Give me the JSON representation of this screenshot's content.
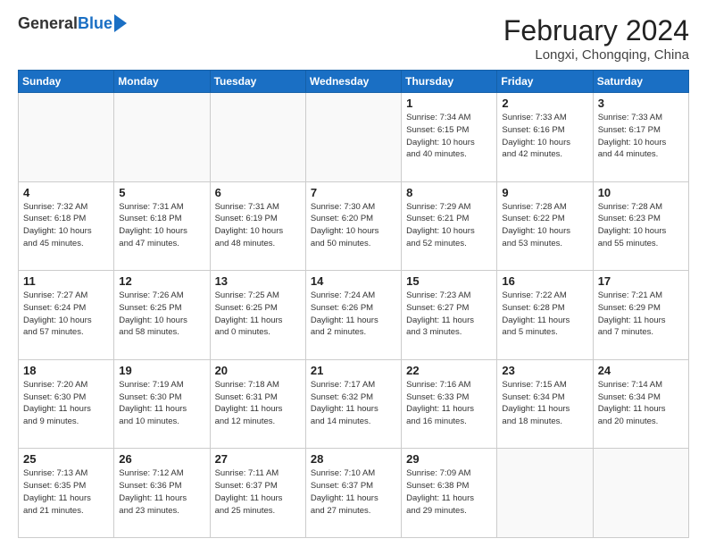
{
  "logo": {
    "general": "General",
    "blue": "Blue"
  },
  "title": {
    "month_year": "February 2024",
    "location": "Longxi, Chongqing, China"
  },
  "headers": [
    "Sunday",
    "Monday",
    "Tuesday",
    "Wednesday",
    "Thursday",
    "Friday",
    "Saturday"
  ],
  "weeks": [
    [
      {
        "day": "",
        "info": ""
      },
      {
        "day": "",
        "info": ""
      },
      {
        "day": "",
        "info": ""
      },
      {
        "day": "",
        "info": ""
      },
      {
        "day": "1",
        "info": "Sunrise: 7:34 AM\nSunset: 6:15 PM\nDaylight: 10 hours\nand 40 minutes."
      },
      {
        "day": "2",
        "info": "Sunrise: 7:33 AM\nSunset: 6:16 PM\nDaylight: 10 hours\nand 42 minutes."
      },
      {
        "day": "3",
        "info": "Sunrise: 7:33 AM\nSunset: 6:17 PM\nDaylight: 10 hours\nand 44 minutes."
      }
    ],
    [
      {
        "day": "4",
        "info": "Sunrise: 7:32 AM\nSunset: 6:18 PM\nDaylight: 10 hours\nand 45 minutes."
      },
      {
        "day": "5",
        "info": "Sunrise: 7:31 AM\nSunset: 6:18 PM\nDaylight: 10 hours\nand 47 minutes."
      },
      {
        "day": "6",
        "info": "Sunrise: 7:31 AM\nSunset: 6:19 PM\nDaylight: 10 hours\nand 48 minutes."
      },
      {
        "day": "7",
        "info": "Sunrise: 7:30 AM\nSunset: 6:20 PM\nDaylight: 10 hours\nand 50 minutes."
      },
      {
        "day": "8",
        "info": "Sunrise: 7:29 AM\nSunset: 6:21 PM\nDaylight: 10 hours\nand 52 minutes."
      },
      {
        "day": "9",
        "info": "Sunrise: 7:28 AM\nSunset: 6:22 PM\nDaylight: 10 hours\nand 53 minutes."
      },
      {
        "day": "10",
        "info": "Sunrise: 7:28 AM\nSunset: 6:23 PM\nDaylight: 10 hours\nand 55 minutes."
      }
    ],
    [
      {
        "day": "11",
        "info": "Sunrise: 7:27 AM\nSunset: 6:24 PM\nDaylight: 10 hours\nand 57 minutes."
      },
      {
        "day": "12",
        "info": "Sunrise: 7:26 AM\nSunset: 6:25 PM\nDaylight: 10 hours\nand 58 minutes."
      },
      {
        "day": "13",
        "info": "Sunrise: 7:25 AM\nSunset: 6:25 PM\nDaylight: 11 hours\nand 0 minutes."
      },
      {
        "day": "14",
        "info": "Sunrise: 7:24 AM\nSunset: 6:26 PM\nDaylight: 11 hours\nand 2 minutes."
      },
      {
        "day": "15",
        "info": "Sunrise: 7:23 AM\nSunset: 6:27 PM\nDaylight: 11 hours\nand 3 minutes."
      },
      {
        "day": "16",
        "info": "Sunrise: 7:22 AM\nSunset: 6:28 PM\nDaylight: 11 hours\nand 5 minutes."
      },
      {
        "day": "17",
        "info": "Sunrise: 7:21 AM\nSunset: 6:29 PM\nDaylight: 11 hours\nand 7 minutes."
      }
    ],
    [
      {
        "day": "18",
        "info": "Sunrise: 7:20 AM\nSunset: 6:30 PM\nDaylight: 11 hours\nand 9 minutes."
      },
      {
        "day": "19",
        "info": "Sunrise: 7:19 AM\nSunset: 6:30 PM\nDaylight: 11 hours\nand 10 minutes."
      },
      {
        "day": "20",
        "info": "Sunrise: 7:18 AM\nSunset: 6:31 PM\nDaylight: 11 hours\nand 12 minutes."
      },
      {
        "day": "21",
        "info": "Sunrise: 7:17 AM\nSunset: 6:32 PM\nDaylight: 11 hours\nand 14 minutes."
      },
      {
        "day": "22",
        "info": "Sunrise: 7:16 AM\nSunset: 6:33 PM\nDaylight: 11 hours\nand 16 minutes."
      },
      {
        "day": "23",
        "info": "Sunrise: 7:15 AM\nSunset: 6:34 PM\nDaylight: 11 hours\nand 18 minutes."
      },
      {
        "day": "24",
        "info": "Sunrise: 7:14 AM\nSunset: 6:34 PM\nDaylight: 11 hours\nand 20 minutes."
      }
    ],
    [
      {
        "day": "25",
        "info": "Sunrise: 7:13 AM\nSunset: 6:35 PM\nDaylight: 11 hours\nand 21 minutes."
      },
      {
        "day": "26",
        "info": "Sunrise: 7:12 AM\nSunset: 6:36 PM\nDaylight: 11 hours\nand 23 minutes."
      },
      {
        "day": "27",
        "info": "Sunrise: 7:11 AM\nSunset: 6:37 PM\nDaylight: 11 hours\nand 25 minutes."
      },
      {
        "day": "28",
        "info": "Sunrise: 7:10 AM\nSunset: 6:37 PM\nDaylight: 11 hours\nand 27 minutes."
      },
      {
        "day": "29",
        "info": "Sunrise: 7:09 AM\nSunset: 6:38 PM\nDaylight: 11 hours\nand 29 minutes."
      },
      {
        "day": "",
        "info": ""
      },
      {
        "day": "",
        "info": ""
      }
    ]
  ]
}
